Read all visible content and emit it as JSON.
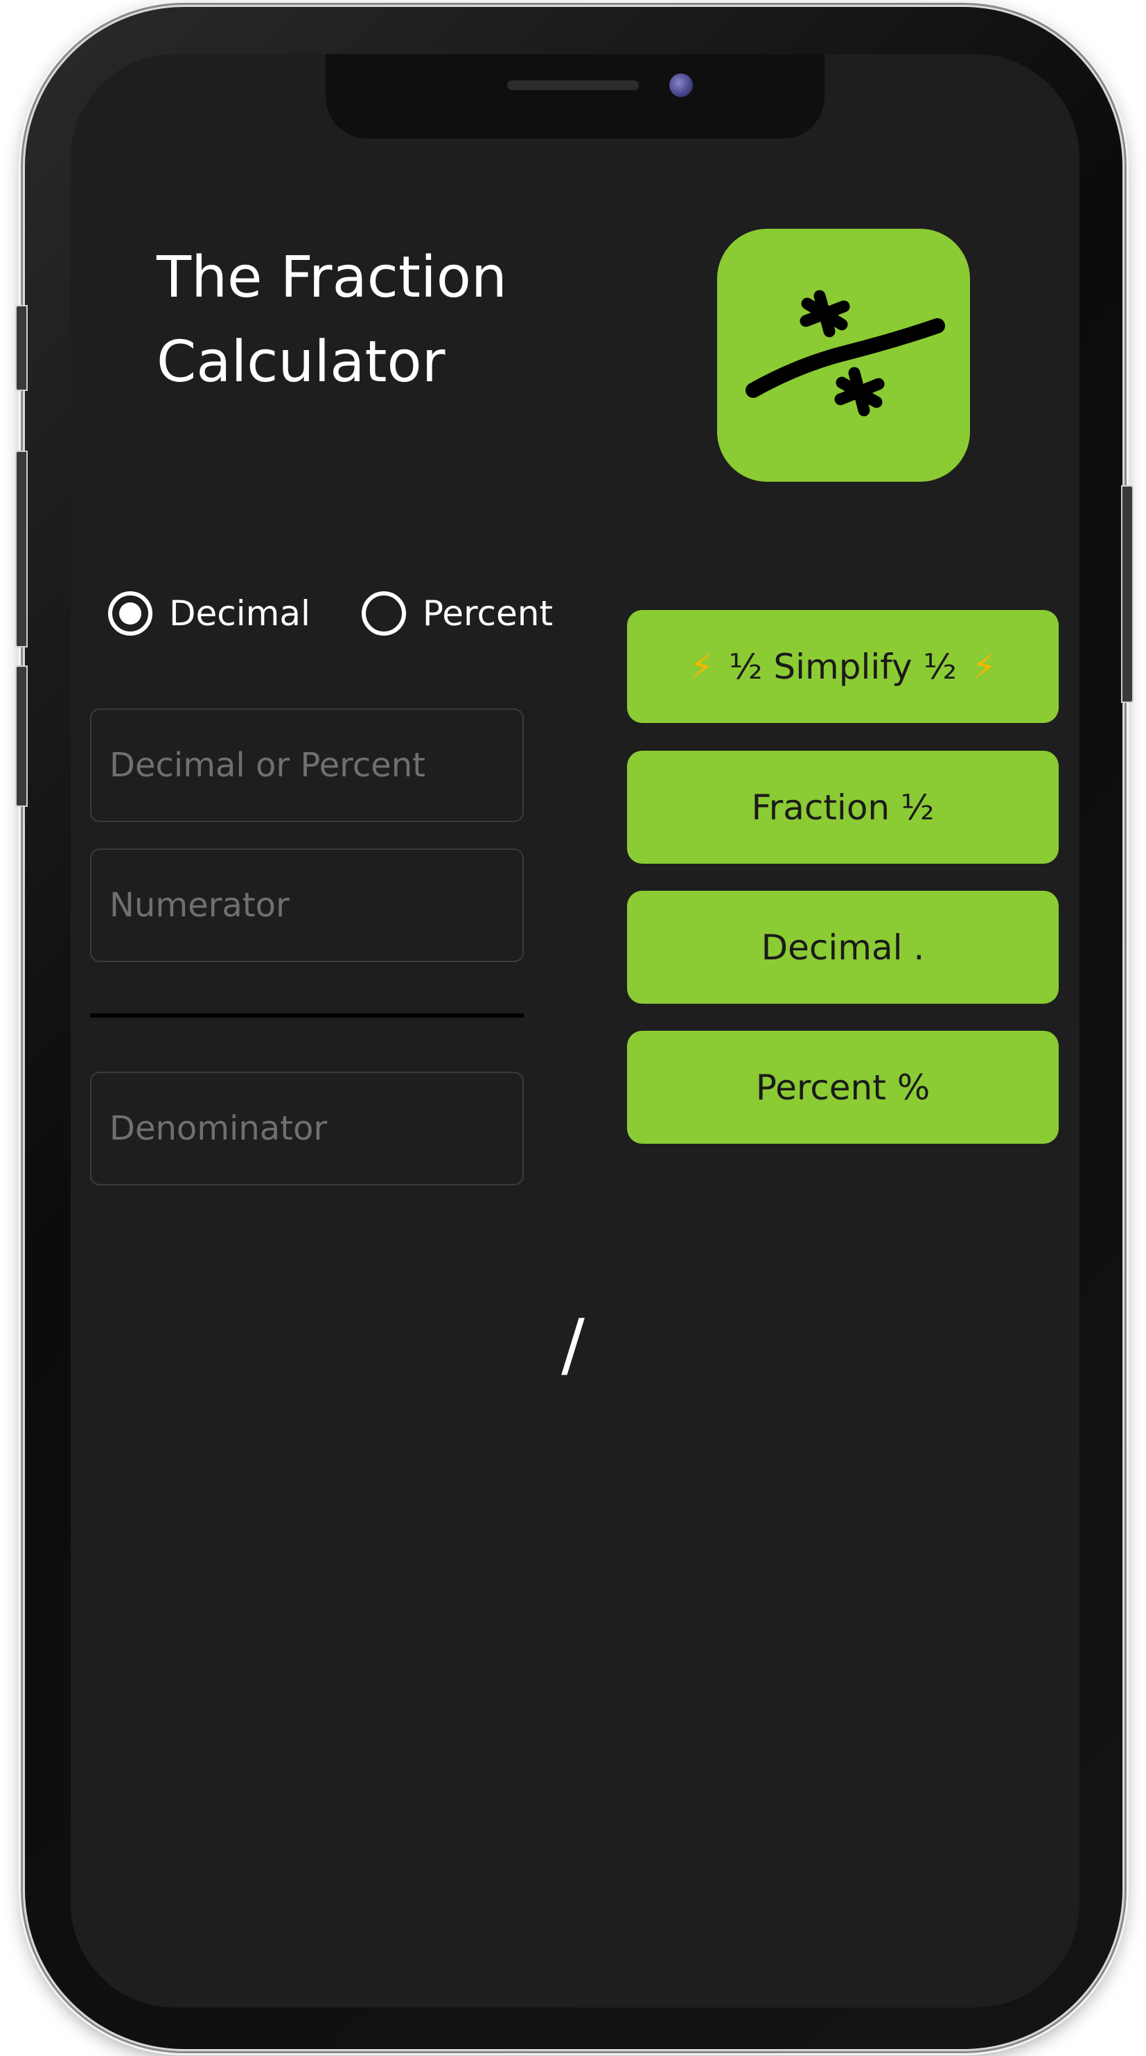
{
  "app": {
    "title_line1": "The Fraction",
    "title_line2": "Calculator",
    "icon": "fraction-asterisk-icon",
    "accent_color": "#8bcb34",
    "background_color": "#1e1e1e"
  },
  "mode_selector": {
    "options": [
      {
        "label": "Decimal",
        "selected": true
      },
      {
        "label": "Percent",
        "selected": false
      }
    ]
  },
  "inputs": {
    "decimal_or_percent": {
      "placeholder": "Decimal or Percent",
      "value": ""
    },
    "numerator": {
      "placeholder": "Numerator",
      "value": ""
    },
    "denominator": {
      "placeholder": "Denominator",
      "value": ""
    }
  },
  "buttons": {
    "simplify": {
      "icon": "lightning-icon",
      "label": "½ Simplify ½",
      "bolt": "⚡"
    },
    "fraction": "Fraction ½",
    "decimal": "Decimal .",
    "percent": "Percent %"
  },
  "result": {
    "text": "/"
  }
}
